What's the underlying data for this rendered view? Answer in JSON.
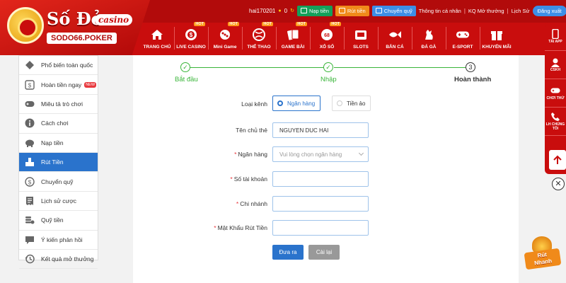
{
  "header": {
    "logo_title": "Số Đỏ",
    "logo_casino": "casino",
    "logo_sub": "SODO66.POKER",
    "username": "hai170201",
    "balance": "0",
    "deposit_label": "Nạp tiền",
    "withdraw_label": "Rút tiền",
    "transfer_label": "Chuyển quỹ",
    "profile_link": "Thông tin cá nhân",
    "results_link": "KQ Mở thưởng",
    "history_link": "Lịch Sử",
    "logout_label": "Đăng xuất",
    "hot_label": "HOT",
    "nav": [
      {
        "label": "TRANG CHỦ",
        "icon": "home-icon",
        "hot": false
      },
      {
        "label": "LIVE CASINO",
        "icon": "casino-chip-icon",
        "hot": true
      },
      {
        "label": "Mini Game",
        "icon": "mini-game-icon",
        "hot": true
      },
      {
        "label": "THỂ THAO",
        "icon": "sports-ball-icon",
        "hot": true
      },
      {
        "label": "GAME BÀI",
        "icon": "cards-icon",
        "hot": true
      },
      {
        "label": "XỔ SỐ",
        "icon": "lottery-icon",
        "hot": true
      },
      {
        "label": "SLOTS",
        "icon": "slot-machine-icon",
        "hot": false
      },
      {
        "label": "BẮN CÁ",
        "icon": "fish-icon",
        "hot": false
      },
      {
        "label": "ĐÁ GÀ",
        "icon": "rooster-icon",
        "hot": false
      },
      {
        "label": "E-SPORT",
        "icon": "gamepad-icon",
        "hot": false
      },
      {
        "label": "KHUYẾN MÃI",
        "icon": "gift-icon",
        "hot": false
      }
    ]
  },
  "sidebar": {
    "items": [
      {
        "label": "Phổ biến toàn quốc",
        "icon": "diamond-icon",
        "active": false
      },
      {
        "label": "Hoàn tiền ngay",
        "icon": "cashback-icon",
        "badge": "NEW",
        "active": false
      },
      {
        "label": "Miêu tả trò chơi",
        "icon": "gamepad-icon",
        "active": false
      },
      {
        "label": "Cách chơi",
        "icon": "info-icon",
        "active": false
      },
      {
        "label": "Nạp tiền",
        "icon": "piggy-bank-icon",
        "active": false
      },
      {
        "label": "Rút Tiền",
        "icon": "withdraw-icon",
        "active": true
      },
      {
        "label": "Chuyển quỹ",
        "icon": "dollar-circle-icon",
        "active": false
      },
      {
        "label": "Lịch sử cược",
        "icon": "receipt-icon",
        "active": false
      },
      {
        "label": "Quỹ tiền",
        "icon": "coins-stack-icon",
        "active": false
      },
      {
        "label": "Ý kiến phản hồi",
        "icon": "chat-bubble-icon",
        "active": false
      },
      {
        "label": "Kết quả mở thưởng",
        "icon": "history-clock-icon",
        "active": false
      }
    ]
  },
  "steps": [
    {
      "number": "1",
      "label": "Bắt đầu",
      "state": "done"
    },
    {
      "number": "2",
      "label": "Nhập",
      "state": "done"
    },
    {
      "number": "3",
      "label": "Hoàn thành",
      "state": "current"
    }
  ],
  "form": {
    "channel_label": "Loại kênh",
    "channel_bank": "Ngân hàng",
    "channel_virtual": "Tiền ảo",
    "holder_label": "Tên chủ thẻ",
    "holder_value": "NGUYEN DUC HAI",
    "bank_label": "Ngân hàng",
    "bank_placeholder": "Vui lòng chọn ngân hàng",
    "account_label": "Số tài khoản",
    "account_value": "",
    "branch_label": "Chi nhánh",
    "branch_value": "",
    "password_label": "Mật Khẩu Rút Tiền",
    "password_value": "",
    "required_mark": "*",
    "submit_label": "Đưa ra",
    "reset_label": "Cài lại"
  },
  "rightbar": {
    "items": [
      {
        "label": "TẢI APP",
        "icon": "phone-app-icon"
      },
      {
        "label": "CSKH",
        "icon": "support-agent-icon"
      },
      {
        "label": "CHƠI THỬ",
        "icon": "controller-icon"
      },
      {
        "label": "LH CHÚNG TÔI",
        "icon": "phone-call-icon"
      }
    ],
    "close_symbol": "✕"
  },
  "promo": {
    "line1": "Rút",
    "line2": "Nhanh"
  },
  "colors": {
    "brand_red": "#c90d0d",
    "active_blue": "#2a73cc",
    "step_green": "#3ab53a",
    "required_red": "#e8383d"
  }
}
